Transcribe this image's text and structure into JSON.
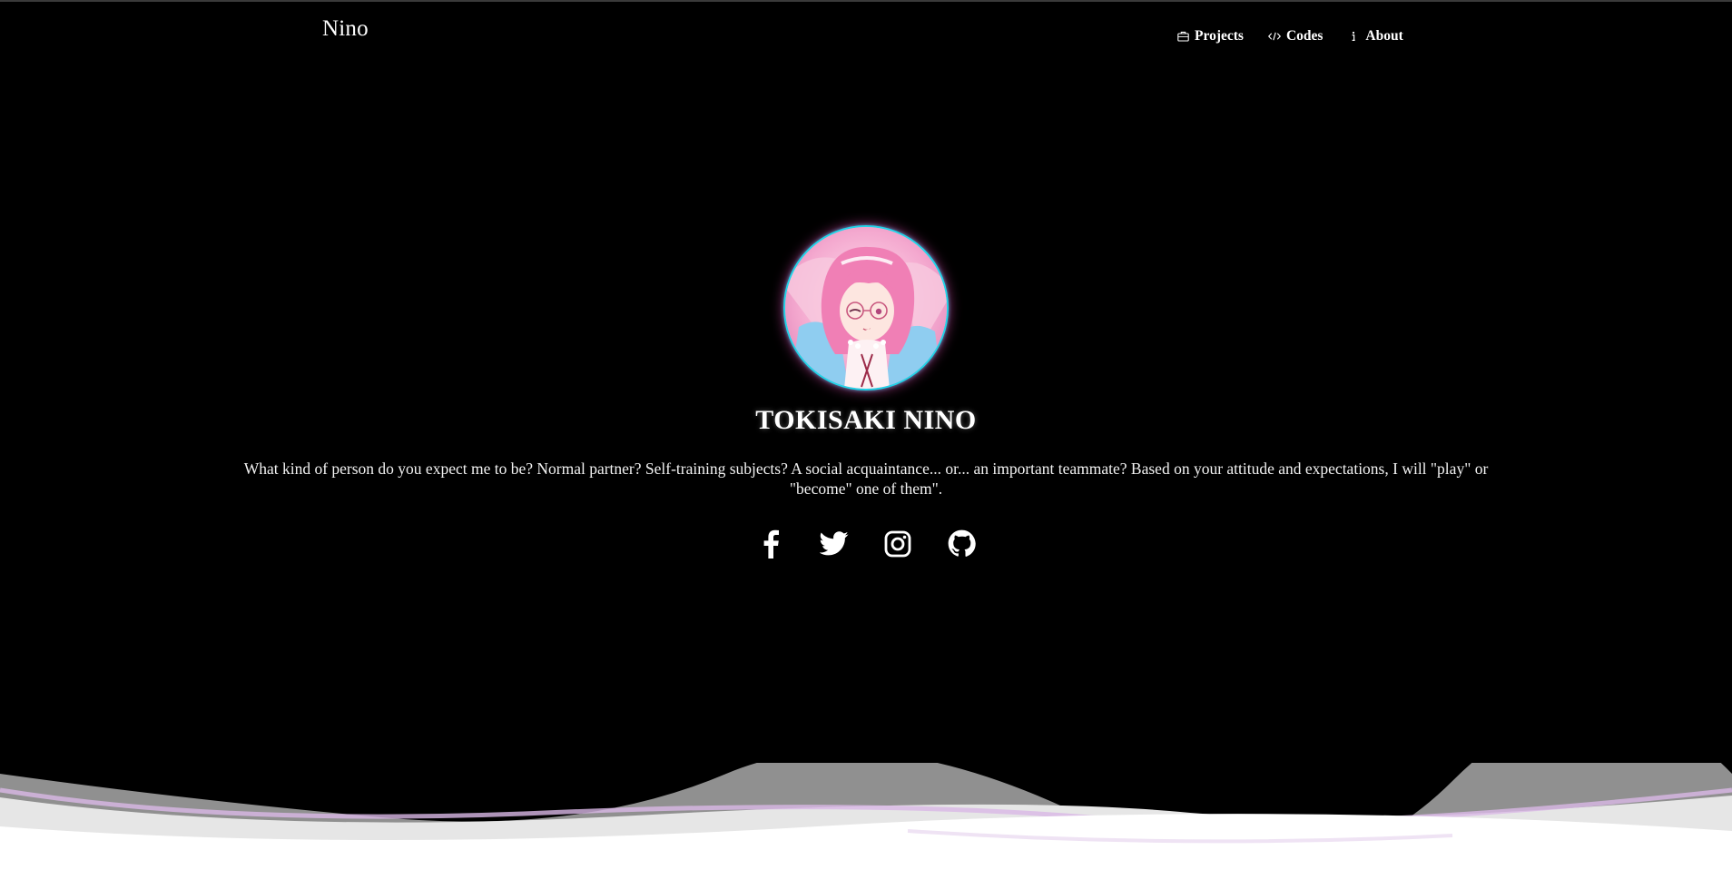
{
  "header": {
    "brand": "Nino",
    "nav": [
      {
        "label": "Projects",
        "icon": "briefcase-icon"
      },
      {
        "label": "Codes",
        "icon": "code-icon"
      },
      {
        "label": "About",
        "icon": "info-icon"
      }
    ]
  },
  "hero": {
    "title": "TOKISAKI NINO",
    "description": "What kind of person do you expect me to be? Normal partner? Self-training subjects? A social acquaintance... or... an important teammate? Based on your attitude and expectations, I will \"play\" or \"become\" one of them\".",
    "socials": [
      {
        "icon": "facebook-icon"
      },
      {
        "icon": "twitter-icon"
      },
      {
        "icon": "instagram-icon"
      },
      {
        "icon": "github-icon"
      }
    ]
  },
  "colors": {
    "background": "#000000",
    "text": "#ffffff",
    "avatar_ring": "#21d4e8",
    "avatar_glow": "#ff5ac8",
    "wave_light": "#e6e6e6",
    "wave_mid": "#a9a9a9",
    "wave_accent": "#d9b8e6"
  }
}
